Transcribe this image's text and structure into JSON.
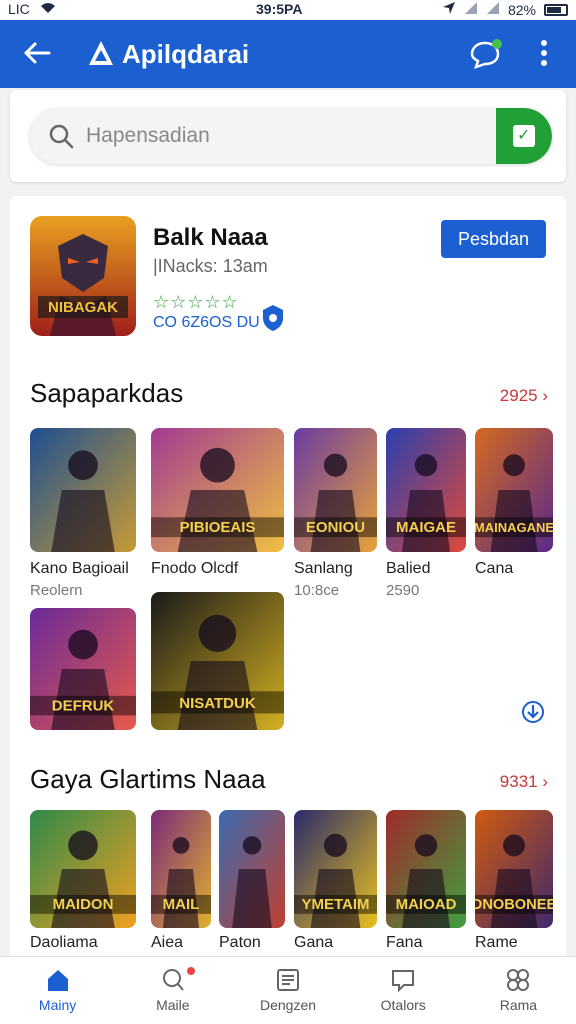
{
  "status": {
    "carrier": "LIC",
    "time": "39:5PA",
    "battery": "82%"
  },
  "app_bar": {
    "title": "Apilqdarai"
  },
  "search": {
    "placeholder": "Hapensadian"
  },
  "featured": {
    "name": "Balk Naaa",
    "subtitle": "|INacks: 13am",
    "rating_text": "☆☆☆☆☆",
    "meta": "CO 6Z6OS DU",
    "install_label": "Pesbdan"
  },
  "section1": {
    "title": "Sapaparkdas",
    "more": "2925 ›",
    "items": [
      {
        "name": "Kano Bagioail",
        "meta": "Reolern",
        "art_text": "",
        "colors": [
          "#1d4f91",
          "#c79a35"
        ]
      },
      {
        "name": "Fnodo Olcdf",
        "meta": "",
        "art_text": "PIBIOEAIS",
        "colors": [
          "#a23b92",
          "#f0c040"
        ]
      },
      {
        "name": "Sanlang",
        "meta": "10:8ce",
        "art_text": "EONIOU",
        "colors": [
          "#6a3aa0",
          "#e8a33a"
        ]
      },
      {
        "name": "Balied",
        "meta": "2590",
        "art_text": "MAIGAE",
        "colors": [
          "#2a3fb0",
          "#e04a3a"
        ]
      },
      {
        "name": "Cana",
        "meta": "",
        "art_text": "MAINAGANE",
        "colors": [
          "#d46a20",
          "#5a2a8a"
        ]
      },
      {
        "name": "",
        "meta": "",
        "art_text": "DEFRUK",
        "colors": [
          "#6a2a9a",
          "#e85a4a"
        ]
      },
      {
        "name": "",
        "meta": "",
        "art_text": "NISATDUK",
        "colors": [
          "#1a1a1a",
          "#d4b020"
        ]
      }
    ]
  },
  "section2": {
    "title": "Gaya Glartims Naaa",
    "more": "9331 ›",
    "items": [
      {
        "name": "Daoliama",
        "art_text": "MAIDON",
        "colors": [
          "#2f8a4a",
          "#f0a020"
        ]
      },
      {
        "name": "Aiea",
        "art_text": "MAIL",
        "colors": [
          "#7a2a7a",
          "#e0b030"
        ]
      },
      {
        "name": "Paton",
        "art_text": "",
        "colors": [
          "#3a6ab0",
          "#c04030"
        ]
      },
      {
        "name": "Gana",
        "art_text": "YMETAIM",
        "colors": [
          "#2a2a6a",
          "#e8c020"
        ]
      },
      {
        "name": "Fana",
        "art_text": "MAIOAD",
        "colors": [
          "#a02a2a",
          "#40a040"
        ]
      },
      {
        "name": "Rame",
        "art_text": "DNOBONEE",
        "colors": [
          "#d05a10",
          "#402a6a"
        ]
      }
    ]
  },
  "nav": [
    {
      "label": "Mainy",
      "icon": "home-icon"
    },
    {
      "label": "Maile",
      "icon": "bag-icon"
    },
    {
      "label": "Dengzen",
      "icon": "list-icon"
    },
    {
      "label": "Otalors",
      "icon": "inbox-icon"
    },
    {
      "label": "Rama",
      "icon": "apps-icon"
    }
  ]
}
